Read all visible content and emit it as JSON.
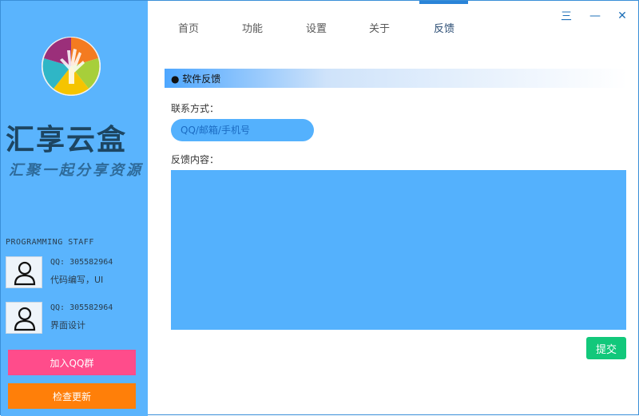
{
  "sidebar": {
    "brand_title": "汇享云盒",
    "brand_subtitle": "汇聚一起分享资源",
    "staff_title": "PROGRAMMING STAFF",
    "staff": [
      {
        "qq": "QQ: 305582964",
        "role": "代码编写，UI"
      },
      {
        "qq": "QQ: 305582964",
        "role": "界面设计"
      }
    ],
    "join_button": "加入QQ群",
    "update_button": "检查更新",
    "colors": {
      "background": "#5ab4fd",
      "join": "#ff4c8b",
      "update": "#ff7f09"
    }
  },
  "nav": {
    "tabs": [
      {
        "label": "首页"
      },
      {
        "label": "功能"
      },
      {
        "label": "设置"
      },
      {
        "label": "关于"
      },
      {
        "label": "反馈"
      }
    ],
    "active_tab": "反馈"
  },
  "window_controls": {
    "menu": "三",
    "minimize": "—",
    "close": "✕"
  },
  "feedback": {
    "section_title": "● 软件反馈",
    "contact_label": "联系方式：",
    "contact_placeholder": "QQ/邮箱/手机号",
    "content_label": "反馈内容：",
    "submit_label": "提交"
  },
  "colors": {
    "accent": "#2a84d8",
    "input_bg": "#54b1fd",
    "submit": "#12c87b"
  }
}
